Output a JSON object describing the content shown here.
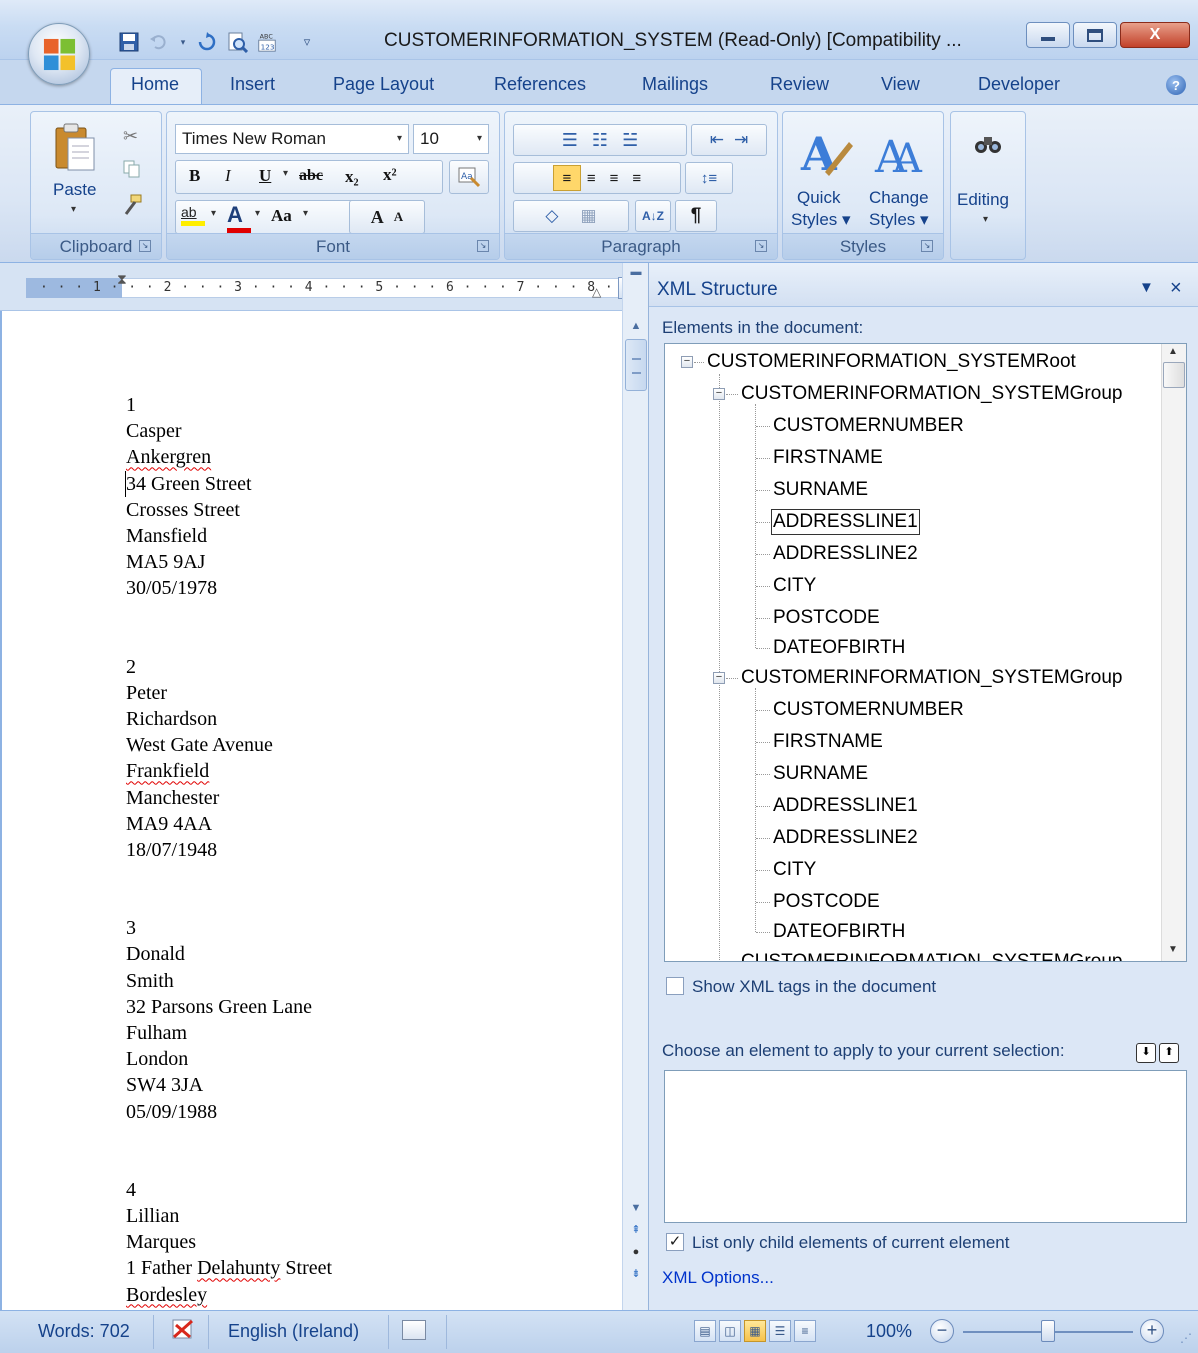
{
  "window": {
    "title": "CUSTOMERINFORMATION_SYSTEM (Read-Only) [Compatibility ...",
    "controls": {
      "minimize": "–",
      "maximize": "□",
      "close": "X"
    }
  },
  "quick_access": [
    "save-icon",
    "undo-icon",
    "redo-icon",
    "print-preview-icon",
    "spelling-icon",
    "customize-icon"
  ],
  "tabs": [
    "Home",
    "Insert",
    "Page Layout",
    "References",
    "Mailings",
    "Review",
    "View",
    "Developer"
  ],
  "active_tab": "Home",
  "ribbon": {
    "clipboard": {
      "label": "Clipboard",
      "paste": "Paste"
    },
    "font": {
      "label": "Font",
      "font_name": "Times New Roman",
      "font_size": "10",
      "bold": "B",
      "italic": "I",
      "underline": "U",
      "strike": "abc",
      "subscript": "x₂",
      "superscript": "x²",
      "change_case": "Aa",
      "grow": "A",
      "shrink": "A",
      "highlight": "ab",
      "font_color": "A"
    },
    "paragraph": {
      "label": "Paragraph",
      "sort": "A↓Z",
      "pilcrow": "¶"
    },
    "styles": {
      "label": "Styles",
      "quick": "Quick",
      "quick2": "Styles",
      "change": "Change",
      "change2": "Styles"
    },
    "editing": {
      "label": "Editing"
    }
  },
  "ruler": {
    "numbers": "· · · 1 · · · 2 · · · 3 · · · 4 · · · 5 · · · 6 · · · 7 · · · 8 ·"
  },
  "document": {
    "records": [
      [
        "1",
        "Casper",
        "Ankergren",
        "34 Green Street",
        "Crosses Street",
        "Mansfield",
        "MA5 9AJ",
        "30/05/1978"
      ],
      [
        "2",
        "Peter",
        "Richardson",
        "West Gate Avenue",
        "Frankfield",
        "Manchester",
        "MA9 4AA",
        "18/07/1948"
      ],
      [
        "3",
        "Donald",
        "Smith",
        "32 Parsons Green Lane",
        "Fulham",
        "London",
        "SW4 3JA",
        "05/09/1988"
      ],
      [
        "4",
        "Lillian",
        "Marques",
        "1 Father Delahunty Street",
        "Bordesley"
      ]
    ]
  },
  "xml_pane": {
    "title": "XML Structure",
    "elements_label": "Elements in the document:",
    "root": "CUSTOMERINFORMATION_SYSTEMRoot",
    "group": "CUSTOMERINFORMATION_SYSTEMGroup",
    "fields": [
      "CUSTOMERNUMBER",
      "FIRSTNAME",
      "SURNAME",
      "ADDRESSLINE1",
      "ADDRESSLINE2",
      "CITY",
      "POSTCODE",
      "DATEOFBIRTH"
    ],
    "selected_field": "ADDRESSLINE1",
    "show_tags": {
      "label": "Show XML tags in the document",
      "checked": false
    },
    "choose_label": "Choose an element to apply to your current selection:",
    "list_children": {
      "label": "List only child elements of current element",
      "checked": true,
      "mark": "✓"
    },
    "options_link": "XML Options..."
  },
  "status": {
    "words": "Words: 702",
    "language": "English (Ireland)",
    "zoom": "100%",
    "zoom_level": 0.5
  }
}
